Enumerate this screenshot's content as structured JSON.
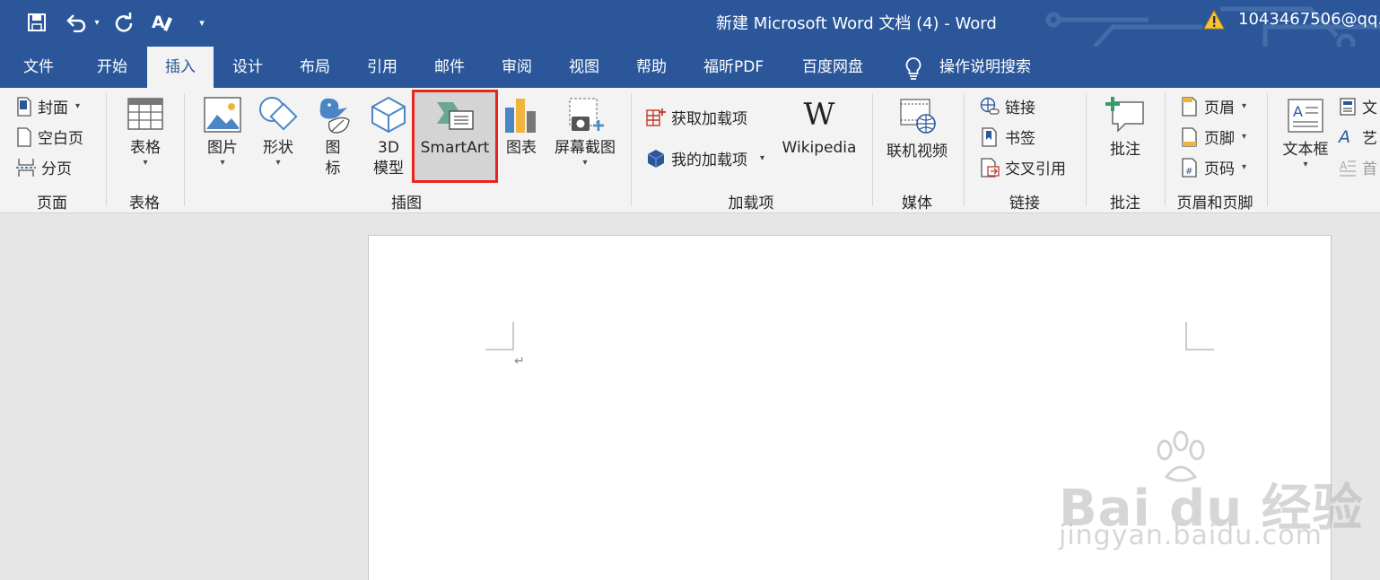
{
  "titlebar": {
    "document_title": "新建 Microsoft Word 文档 (4)  -  Word",
    "account": "1043467506@qq.",
    "bg_color": "#2b579a"
  },
  "qat": {
    "icons": [
      "save-icon",
      "undo-icon",
      "redo-icon",
      "spelling-icon",
      "customize-qat-icon"
    ]
  },
  "tabs": [
    {
      "label": "文件"
    },
    {
      "label": "开始"
    },
    {
      "label": "插入",
      "active": true
    },
    {
      "label": "设计"
    },
    {
      "label": "布局"
    },
    {
      "label": "引用"
    },
    {
      "label": "邮件"
    },
    {
      "label": "审阅"
    },
    {
      "label": "视图"
    },
    {
      "label": "帮助"
    },
    {
      "label": "福昕PDF"
    },
    {
      "label": "百度网盘"
    }
  ],
  "tell_me": {
    "label": "操作说明搜索"
  },
  "ribbon": {
    "pages": {
      "group_label": "页面",
      "cover": "封面",
      "blank_page": "空白页",
      "page_break": "分页"
    },
    "tables": {
      "group_label": "表格",
      "table": "表格"
    },
    "illustrations": {
      "group_label": "插图",
      "pictures": "图片",
      "shapes": "形状",
      "icons_line1": "图",
      "icons_line2": "标",
      "model3d_line1": "3D",
      "model3d_line2": "模型",
      "smartart": "SmartArt",
      "chart": "图表",
      "screenshot": "屏幕截图"
    },
    "addins": {
      "group_label": "加载项",
      "get_addins": "获取加载项",
      "my_addins": "我的加载项",
      "wikipedia": "Wikipedia",
      "wiki_logo": "W"
    },
    "media": {
      "group_label": "媒体",
      "online_video": "联机视频"
    },
    "links": {
      "group_label": "链接",
      "link": "链接",
      "bookmark": "书签",
      "cross_ref": "交叉引用"
    },
    "comments": {
      "group_label": "批注",
      "comment": "批注"
    },
    "header_footer": {
      "group_label": "页眉和页脚",
      "header": "页眉",
      "footer": "页脚",
      "page_number": "页码"
    },
    "text": {
      "textbox": "文本框",
      "quick_parts": "文",
      "wordart": "艺",
      "drop_cap": "首"
    },
    "highlight_color": "#e8241f"
  },
  "document": {
    "paragraph_mark": "↵"
  },
  "watermark": {
    "main": "Bai du 经验",
    "sub": "jingyan.baidu.com"
  }
}
